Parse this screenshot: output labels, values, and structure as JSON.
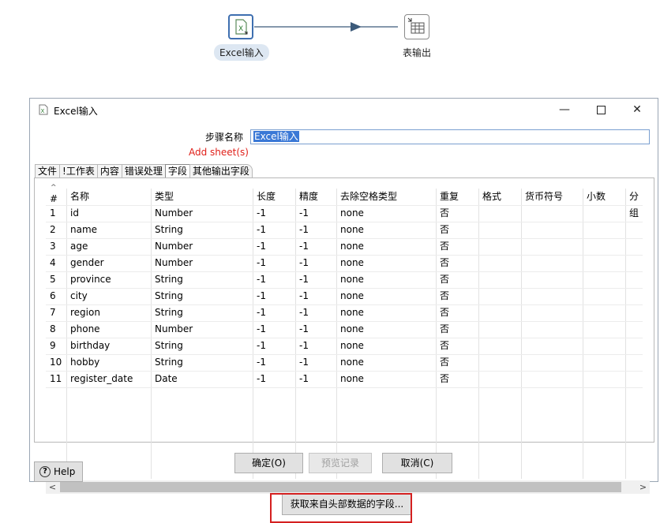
{
  "canvas": {
    "nodes": [
      {
        "label": "Excel输入",
        "icon": "excel-file-icon"
      },
      {
        "label": "表输出",
        "icon": "table-output-icon"
      }
    ]
  },
  "dialog": {
    "title": "Excel输入",
    "step_name_label": "步骤名称",
    "step_name_value": "Excel输入",
    "add_sheet": "Add sheet(s)",
    "tabs": [
      "文件",
      "!工作表",
      "内容",
      "错误处理",
      "字段",
      "其他输出字段"
    ],
    "active_tab": "字段",
    "table": {
      "headers": [
        "#",
        "名称",
        "类型",
        "长度",
        "精度",
        "去除空格类型",
        "重复",
        "格式",
        "货币符号",
        "小数",
        "分组"
      ],
      "rows": [
        [
          "1",
          "id",
          "Number",
          "-1",
          "-1",
          "none",
          "否"
        ],
        [
          "2",
          "name",
          "String",
          "-1",
          "-1",
          "none",
          "否"
        ],
        [
          "3",
          "age",
          "Number",
          "-1",
          "-1",
          "none",
          "否"
        ],
        [
          "4",
          "gender",
          "Number",
          "-1",
          "-1",
          "none",
          "否"
        ],
        [
          "5",
          "province",
          "String",
          "-1",
          "-1",
          "none",
          "否"
        ],
        [
          "6",
          "city",
          "String",
          "-1",
          "-1",
          "none",
          "否"
        ],
        [
          "7",
          "region",
          "String",
          "-1",
          "-1",
          "none",
          "否"
        ],
        [
          "8",
          "phone",
          "Number",
          "-1",
          "-1",
          "none",
          "否"
        ],
        [
          "9",
          "birthday",
          "String",
          "-1",
          "-1",
          "none",
          "否"
        ],
        [
          "10",
          "hobby",
          "String",
          "-1",
          "-1",
          "none",
          "否"
        ],
        [
          "11",
          "register_date",
          "Date",
          "-1",
          "-1",
          "none",
          "否"
        ]
      ]
    },
    "fetch_button": "获取来自头部数据的字段...",
    "buttons": {
      "ok": "确定(O)",
      "preview": "预览记录",
      "cancel": "取消(C)"
    },
    "help": "Help",
    "highlight_color": "#d42020"
  }
}
